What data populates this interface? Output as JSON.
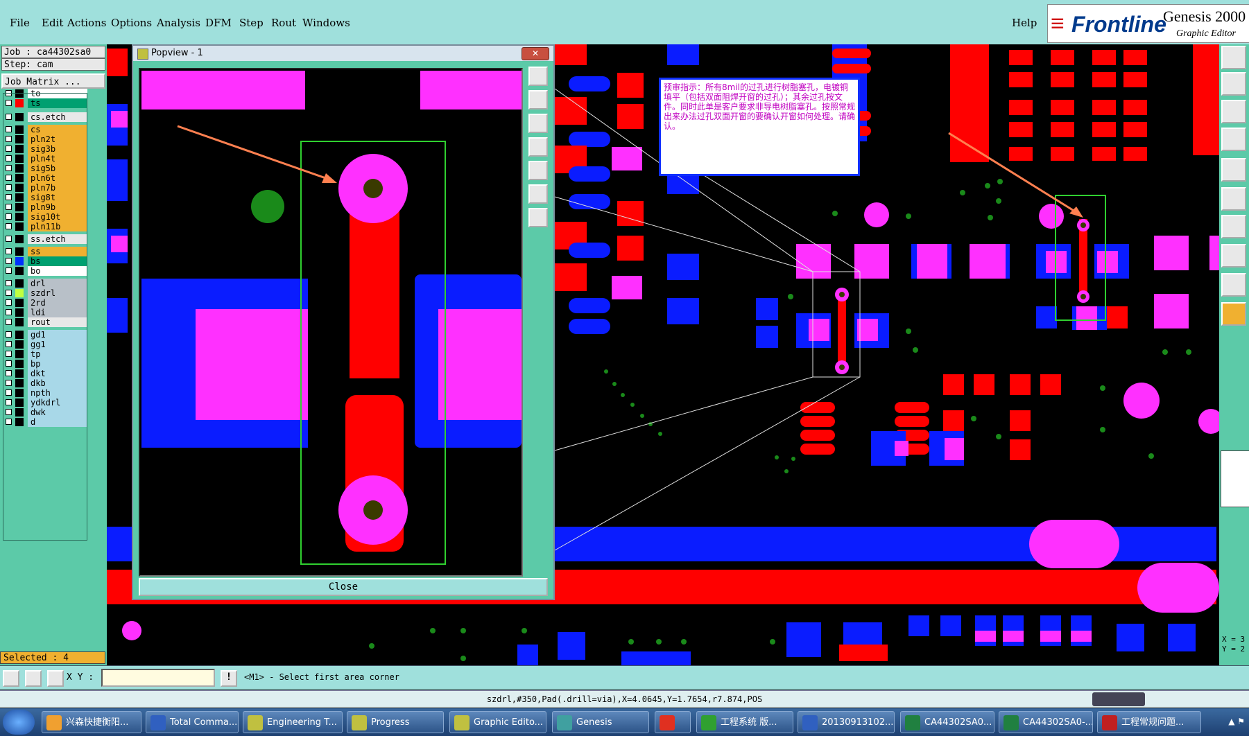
{
  "menu": {
    "items": [
      "File",
      "Edit",
      "Actions",
      "Options",
      "Analysis",
      "DFM",
      "Step",
      "Rout",
      "Windows"
    ],
    "help": "Help"
  },
  "logo": {
    "brand": "Frontline",
    "product": "Genesis 2000",
    "subtitle": "Graphic Editor"
  },
  "job": {
    "job": "Job : ca44302sa0",
    "step": "Step: cam",
    "matrix_button": "Job Matrix ..."
  },
  "layers": [
    {
      "name": "to",
      "color": "#ffffff",
      "swatch": "#000000"
    },
    {
      "name": "ts",
      "color": "#00a070",
      "swatch": "#ff0000"
    },
    {
      "name": "cs.etch",
      "color": "#e8e8e8",
      "swatch": "#000000"
    },
    {
      "name": "cs",
      "color": "#f0b030",
      "swatch": "#000000"
    },
    {
      "name": "pln2t",
      "color": "#f0b030",
      "swatch": "#000000"
    },
    {
      "name": "sig3b",
      "color": "#f0b030",
      "swatch": "#000000"
    },
    {
      "name": "pln4t",
      "color": "#f0b030",
      "swatch": "#000000"
    },
    {
      "name": "sig5b",
      "color": "#f0b030",
      "swatch": "#000000"
    },
    {
      "name": "pln6t",
      "color": "#f0b030",
      "swatch": "#000000"
    },
    {
      "name": "pln7b",
      "color": "#f0b030",
      "swatch": "#000000"
    },
    {
      "name": "sig8t",
      "color": "#f0b030",
      "swatch": "#000000"
    },
    {
      "name": "pln9b",
      "color": "#f0b030",
      "swatch": "#000000"
    },
    {
      "name": "sig10t",
      "color": "#f0b030",
      "swatch": "#000000"
    },
    {
      "name": "pln11b",
      "color": "#f0b030",
      "swatch": "#000000"
    },
    {
      "name": "ss.etch",
      "color": "#e8e8e8",
      "swatch": "#000000"
    },
    {
      "name": "ss",
      "color": "#f0b030",
      "swatch": "#000000"
    },
    {
      "name": "bs",
      "color": "#00a070",
      "swatch": "#0030ff"
    },
    {
      "name": "bo",
      "color": "#ffffff",
      "swatch": "#000000"
    },
    {
      "name": "drl",
      "color": "#b8c0c8",
      "swatch": "#000000"
    },
    {
      "name": "szdrl",
      "color": "#b8c0c8",
      "swatch": "#c0ff40"
    },
    {
      "name": "2rd",
      "color": "#b8c0c8",
      "swatch": "#000000"
    },
    {
      "name": "ldi",
      "color": "#b8c0c8",
      "swatch": "#000000"
    },
    {
      "name": "rout",
      "color": "#e8e8e8",
      "swatch": "#000000"
    },
    {
      "name": "gd1",
      "color": "#a8d8e8",
      "swatch": "#000000"
    },
    {
      "name": "gg1",
      "color": "#a8d8e8",
      "swatch": "#000000"
    },
    {
      "name": "tp",
      "color": "#a8d8e8",
      "swatch": "#000000"
    },
    {
      "name": "bp",
      "color": "#a8d8e8",
      "swatch": "#000000"
    },
    {
      "name": "dkt",
      "color": "#a8d8e8",
      "swatch": "#000000"
    },
    {
      "name": "dkb",
      "color": "#a8d8e8",
      "swatch": "#000000"
    },
    {
      "name": "npth",
      "color": "#a8d8e8",
      "swatch": "#000000"
    },
    {
      "name": "ydkdrl",
      "color": "#a8d8e8",
      "swatch": "#000000"
    },
    {
      "name": "dwk",
      "color": "#a8d8e8",
      "swatch": "#000000"
    },
    {
      "name": "d",
      "color": "#a8d8e8",
      "swatch": "#000000"
    }
  ],
  "selected": "Selected : 4",
  "popup": {
    "title": "Popview - 1",
    "close_x": "✕",
    "close_button": "Close"
  },
  "annotation": "预审指示：所有8mil的过孔进行树脂塞孔，电镀铜填平（包括双面阻焊开窗的过孔）；其余过孔按文件。同时此单是客户要求非导电树脂塞孔。按照常规出来办法过孔双面开窗的要确认开窗如何处理。请确认。",
  "command": {
    "xy_label": "X Y :",
    "xy_value": "",
    "prompt": "<M1> - Select first area corner"
  },
  "status": "szdrl,#350,Pad(.drill=via),X=4.0645,Y=1.7654,r7.874,POS",
  "coords": {
    "x": "X = 3",
    "y": "Y = 2"
  },
  "taskbar": [
    {
      "label": "兴森快捷衡阳...",
      "icon": "#f0a030"
    },
    {
      "label": "Total Comma...",
      "icon": "#3060c0"
    },
    {
      "label": "Engineering T...",
      "icon": "#c0c040"
    },
    {
      "label": "Progress",
      "icon": "#c0c040"
    },
    {
      "label": "Graphic Edito...",
      "icon": "#c0c040"
    },
    {
      "label": "Genesis",
      "icon": "#40a0a0"
    },
    {
      "label": "",
      "icon": "#e03020"
    },
    {
      "label": "工程系统  版...",
      "icon": "#30a030"
    },
    {
      "label": "20130913102...",
      "icon": "#3060c0"
    },
    {
      "label": "CA44302SA0...",
      "icon": "#208040"
    },
    {
      "label": "CA44302SA0-...",
      "icon": "#208040"
    },
    {
      "label": "工程常规问题...",
      "icon": "#c02020"
    }
  ],
  "colors": {
    "magenta": "#ff30ff",
    "red": "#ff0000",
    "blue": "#0a1cff",
    "green": "#1a8a1a",
    "accent": "#5ccaa8"
  }
}
